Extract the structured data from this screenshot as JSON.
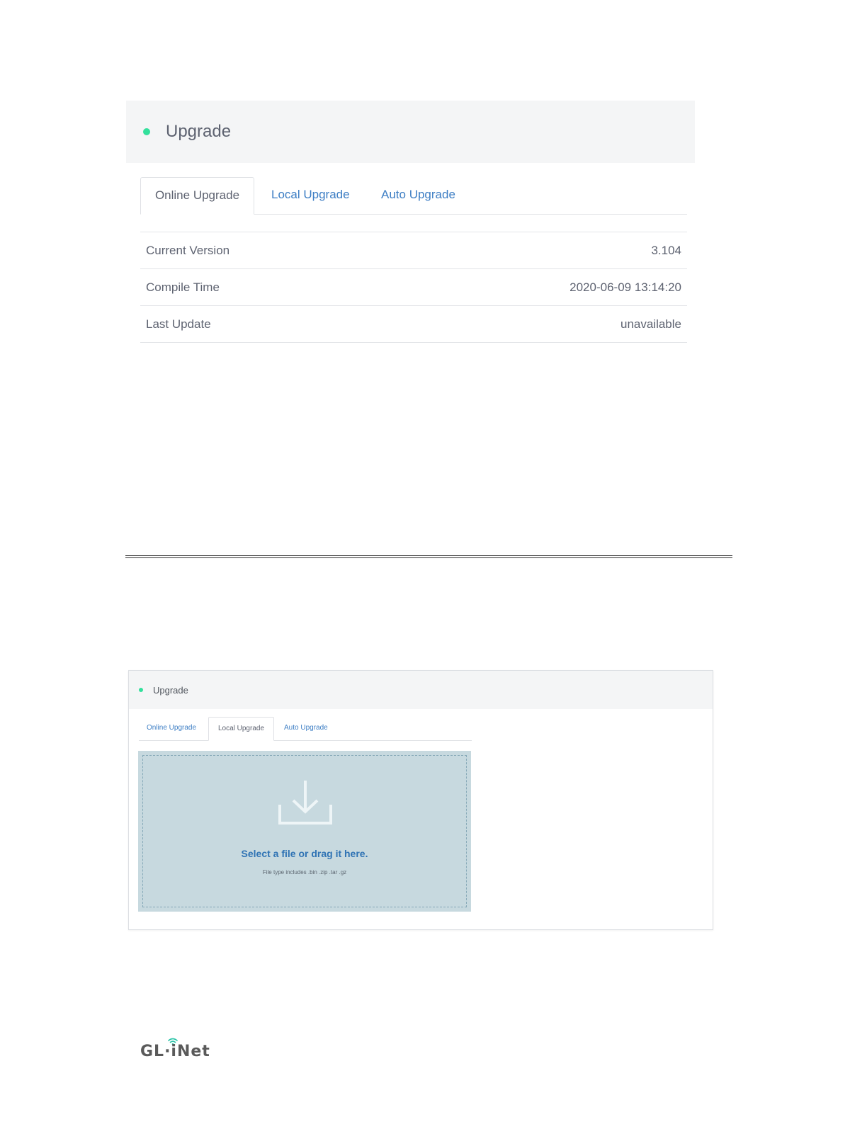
{
  "screen1": {
    "title": "Upgrade",
    "tabs": [
      {
        "label": "Online Upgrade",
        "active": true
      },
      {
        "label": "Local Upgrade",
        "active": false
      },
      {
        "label": "Auto Upgrade",
        "active": false
      }
    ],
    "info_rows": [
      {
        "label": "Current Version",
        "value": "3.104"
      },
      {
        "label": "Compile Time",
        "value": "2020-06-09 13:14:20"
      },
      {
        "label": "Last Update",
        "value": "unavailable"
      }
    ]
  },
  "screen2": {
    "title": "Upgrade",
    "tabs": [
      {
        "label": "Online Upgrade",
        "active": false
      },
      {
        "label": "Local Upgrade",
        "active": true
      },
      {
        "label": "Auto Upgrade",
        "active": false
      }
    ],
    "dropzone": {
      "icon": "download-icon",
      "main_text": "Select a file or drag it here.",
      "sub_text": "File type includes .bin .zip .tar .gz"
    }
  },
  "footer": {
    "logo_text": "GL·iNet",
    "logo_icon": "wifi-icon"
  },
  "colors": {
    "status_dot": "#33e09c",
    "link": "#3d7ec4",
    "dropzone_bg": "#c7d9df",
    "dropzone_text": "#2f73b4"
  }
}
